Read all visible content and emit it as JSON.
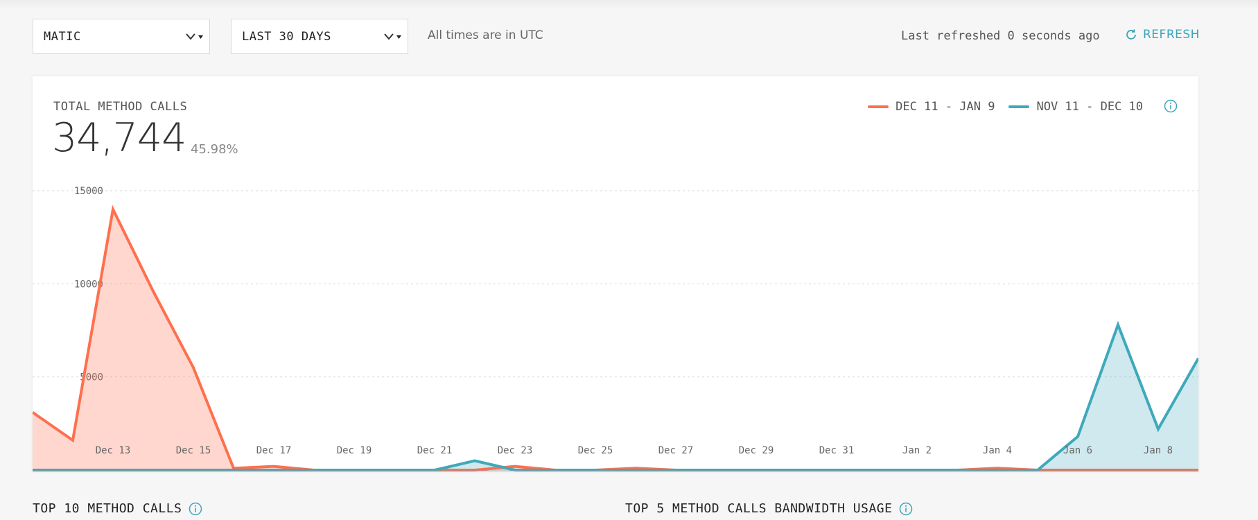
{
  "filters": {
    "network": "MATIC",
    "range": "LAST 30 DAYS",
    "tz_note": "All times are in UTC"
  },
  "status": {
    "refreshed": "Last refreshed 0 seconds ago",
    "refresh_label": "REFRESH"
  },
  "card": {
    "title": "TOTAL METHOD CALLS",
    "total": "34,744",
    "change": "45.98%"
  },
  "sections": {
    "top10": "TOP 10 METHOD CALLS",
    "top5": "TOP 5 METHOD CALLS BANDWIDTH USAGE"
  },
  "colors": {
    "current": "#ff6f4e",
    "previous": "#3ea9ba",
    "accent": "#3aa6b9"
  },
  "chart_data": {
    "type": "area",
    "ylim": [
      0,
      15000
    ],
    "yticks": [
      5000,
      10000,
      15000
    ],
    "x_tick_labels": [
      "Dec 13",
      "Dec 15",
      "Dec 17",
      "Dec 19",
      "Dec 21",
      "Dec 23",
      "Dec 25",
      "Dec 27",
      "Dec 29",
      "Dec 31",
      "Jan 2",
      "Jan 4",
      "Jan 6",
      "Jan 8"
    ],
    "x_tick_index": [
      2,
      4,
      6,
      8,
      10,
      12,
      14,
      16,
      18,
      20,
      22,
      24,
      26,
      28
    ],
    "grid": true,
    "legend_position": "top-right",
    "series": [
      {
        "name": "DEC 11 - JAN 9",
        "color": "#ff6f4e",
        "values": [
          3100,
          1600,
          14000,
          9600,
          5500,
          100,
          200,
          0,
          0,
          0,
          0,
          0,
          200,
          0,
          0,
          100,
          0,
          0,
          0,
          0,
          0,
          0,
          0,
          0,
          100,
          0,
          0,
          0,
          0,
          0
        ]
      },
      {
        "name": "NOV 11 - DEC 10",
        "color": "#3ea9ba",
        "values": [
          0,
          0,
          0,
          0,
          0,
          0,
          0,
          0,
          0,
          0,
          0,
          500,
          0,
          0,
          0,
          0,
          0,
          0,
          0,
          0,
          0,
          0,
          0,
          0,
          0,
          0,
          1800,
          7800,
          2200,
          6000
        ]
      }
    ]
  }
}
